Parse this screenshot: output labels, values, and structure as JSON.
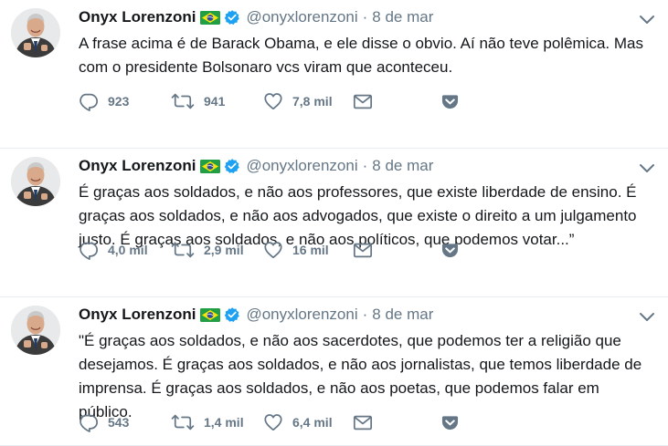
{
  "tweets": [
    {
      "name": "Onyx Lorenzoni",
      "handle": "@onyxlorenzoni",
      "separator": "·",
      "date": "8 de mar",
      "text": "A frase acima é de Barack Obama, e ele disse o obvio. Aí não teve polêmica.  Mas com o presidente Bolsonaro vcs viram que aconteceu.",
      "replies": "923",
      "retweets": "941",
      "likes": "7,8 mil"
    },
    {
      "name": "Onyx Lorenzoni",
      "handle": "@onyxlorenzoni",
      "separator": "·",
      "date": "8 de mar",
      "text": "É graças aos soldados, e não aos professores, que existe liberdade de ensino. É graças aos soldados, e não aos advogados, que existe o direito a um julgamento justo. É graças aos soldados, e não aos políticos, que podemos votar...”",
      "replies": "4,0 mil",
      "retweets": "2,9 mil",
      "likes": "16 mil"
    },
    {
      "name": "Onyx Lorenzoni",
      "handle": "@onyxlorenzoni",
      "separator": "·",
      "date": "8 de mar",
      "text": "\"É graças aos soldados, e não aos sacerdotes, que podemos ter a religião que desejamos. É graças aos soldados, e não aos jornalistas, que temos liberdade de imprensa. É graças aos soldados, e não aos poetas, que podemos falar em público.",
      "replies": "543",
      "retweets": "1,4 mil",
      "likes": "6,4 mil"
    }
  ],
  "icons": {
    "reply": "reply-icon",
    "retweet": "retweet-icon",
    "like": "heart-icon",
    "dm": "envelope-icon",
    "pocket": "pocket-icon",
    "flag": "brazil-flag-icon",
    "verified": "verified-badge-icon",
    "caret": "chevron-down-icon"
  },
  "colors": {
    "text": "#14171a",
    "muted": "#657786",
    "verified": "#1da1f2",
    "divider": "#e6ecf0",
    "pocket": "#657786"
  }
}
